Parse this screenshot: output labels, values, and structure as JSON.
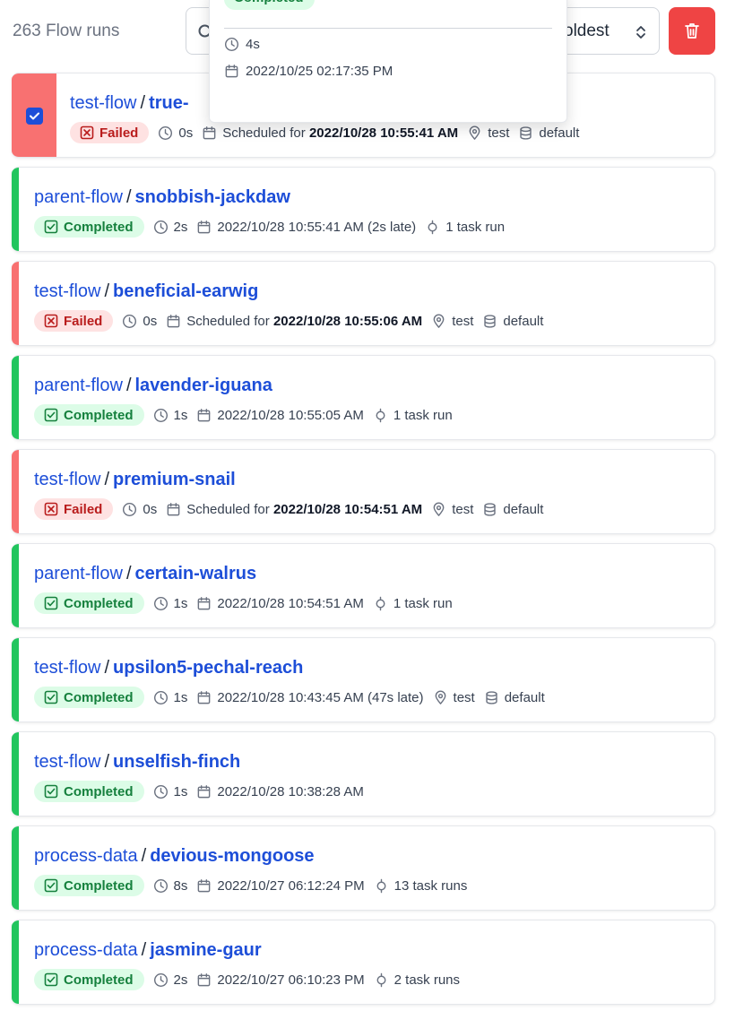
{
  "header": {
    "count_label": "263 Flow runs",
    "sort_label": "oldest"
  },
  "colors": {
    "completed": "#22c55e",
    "failed": "#f87171",
    "link": "#1d4ed8",
    "delete_button": "#ef4444"
  },
  "popover": {
    "state": "Completed",
    "duration": "4s",
    "date": "2022/10/25 02:17:35 PM"
  },
  "runs": [
    {
      "flow": "test-flow",
      "name": "true-",
      "state": "Failed",
      "duration": "0s",
      "schedule_prefix": "Scheduled for",
      "date": "2022/10/28 10:55:41 AM",
      "tag": "test",
      "storage": "default",
      "selected": true
    },
    {
      "flow": "parent-flow",
      "name": "snobbish-jackdaw",
      "state": "Completed",
      "duration": "2s",
      "date": "2022/10/28 10:55:41 AM (2s late)",
      "tasks": "1 task run"
    },
    {
      "flow": "test-flow",
      "name": "beneficial-earwig",
      "state": "Failed",
      "duration": "0s",
      "schedule_prefix": "Scheduled for",
      "date": "2022/10/28 10:55:06 AM",
      "tag": "test",
      "storage": "default"
    },
    {
      "flow": "parent-flow",
      "name": "lavender-iguana",
      "state": "Completed",
      "duration": "1s",
      "date": "2022/10/28 10:55:05 AM",
      "tasks": "1 task run"
    },
    {
      "flow": "test-flow",
      "name": "premium-snail",
      "state": "Failed",
      "duration": "0s",
      "schedule_prefix": "Scheduled for",
      "date": "2022/10/28 10:54:51 AM",
      "tag": "test",
      "storage": "default"
    },
    {
      "flow": "parent-flow",
      "name": "certain-walrus",
      "state": "Completed",
      "duration": "1s",
      "date": "2022/10/28 10:54:51 AM",
      "tasks": "1 task run"
    },
    {
      "flow": "test-flow",
      "name": "upsilon5-pechal-reach",
      "state": "Completed",
      "duration": "1s",
      "date": "2022/10/28 10:43:45 AM (47s late)",
      "tag": "test",
      "storage": "default"
    },
    {
      "flow": "test-flow",
      "name": "unselfish-finch",
      "state": "Completed",
      "duration": "1s",
      "date": "2022/10/28 10:38:28 AM"
    },
    {
      "flow": "process-data",
      "name": "devious-mongoose",
      "state": "Completed",
      "duration": "8s",
      "date": "2022/10/27 06:12:24 PM",
      "tasks": "13 task runs"
    },
    {
      "flow": "process-data",
      "name": "jasmine-gaur",
      "state": "Completed",
      "duration": "2s",
      "date": "2022/10/27 06:10:23 PM",
      "tasks": "2 task runs"
    }
  ]
}
